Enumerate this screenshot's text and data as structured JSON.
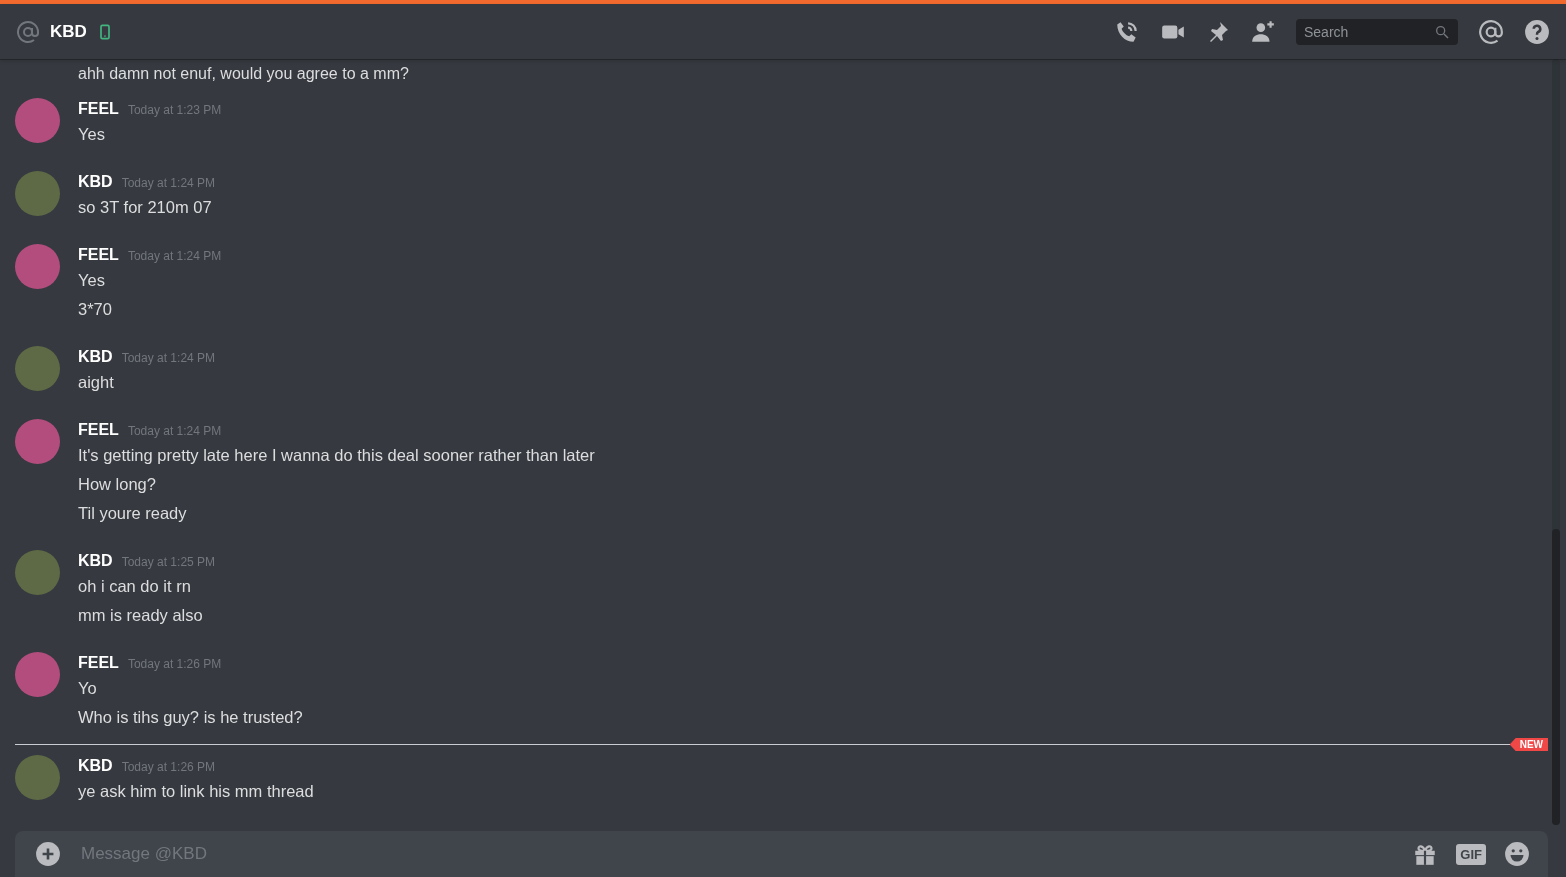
{
  "header": {
    "title": "KBD",
    "search": {
      "placeholder": "Search"
    }
  },
  "scrolled_line": "ahh damn not enuf, would you agree to a mm?",
  "groups": [
    {
      "author": "FEEL",
      "timestamp": "Today at 1:23 PM",
      "color": "#b34d7e",
      "new_divider": false,
      "lines": [
        "Yes"
      ]
    },
    {
      "author": "KBD",
      "timestamp": "Today at 1:24 PM",
      "color": "#5d6a45",
      "new_divider": false,
      "lines": [
        "so 3T for 210m 07"
      ]
    },
    {
      "author": "FEEL",
      "timestamp": "Today at 1:24 PM",
      "color": "#b34d7e",
      "new_divider": false,
      "lines": [
        "Yes",
        "3*70"
      ]
    },
    {
      "author": "KBD",
      "timestamp": "Today at 1:24 PM",
      "color": "#5d6a45",
      "new_divider": false,
      "lines": [
        "aight"
      ]
    },
    {
      "author": "FEEL",
      "timestamp": "Today at 1:24 PM",
      "color": "#b34d7e",
      "new_divider": false,
      "lines": [
        "It's getting pretty late here I wanna do this deal sooner rather than later",
        "How long?",
        "Til youre ready"
      ]
    },
    {
      "author": "KBD",
      "timestamp": "Today at 1:25 PM",
      "color": "#5d6a45",
      "new_divider": false,
      "lines": [
        "oh i can do it rn",
        "mm is ready also"
      ]
    },
    {
      "author": "FEEL",
      "timestamp": "Today at 1:26 PM",
      "color": "#b34d7e",
      "new_divider": false,
      "lines": [
        "Yo",
        "Who is tihs guy? is he trusted?"
      ]
    },
    {
      "author": "KBD",
      "timestamp": "Today at 1:26 PM",
      "color": "#5d6a45",
      "new_divider": true,
      "lines": [
        "ye ask him to link his mm thread"
      ]
    }
  ],
  "new_badge": "NEW",
  "composer": {
    "placeholder": "Message @KBD",
    "gif_label": "GIF"
  }
}
